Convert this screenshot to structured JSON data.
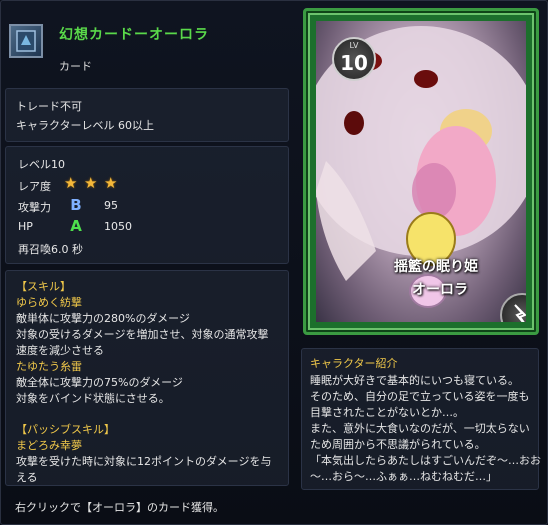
{
  "header": {
    "title": "幻想カードーオーロラ",
    "subtitle": "カード"
  },
  "trade": {
    "line1": "トレード不可",
    "line2": "キャラクターレベル 60以上"
  },
  "stats": {
    "level": "レベル10",
    "rarity_label": "レア度",
    "rarity_stars": 3,
    "attack_label": "攻撃力",
    "attack_grade": "B",
    "attack_value": "95",
    "hp_label": "HP",
    "hp_grade": "A",
    "hp_value": "1050",
    "resummon": "再召喚6.0 秒"
  },
  "skills": {
    "skill_header": "【スキル】",
    "skill1_name": "ゆらめく紡撃",
    "skill1_line1": "敵単体に攻撃力の280%のダメージ",
    "skill1_line2": "対象の受けるダメージを増加させ、対象の通常攻撃",
    "skill1_line3": "速度を減少させる",
    "skill2_name": "たゆたう糸雷",
    "skill2_line1": "敵全体に攻撃力の75%のダメージ",
    "skill2_line2": "対象をバインド状態にさせる。",
    "passive_header": "【パッシブスキル】",
    "passive_name": "まどろみ幸夢",
    "passive_line1": "攻撃を受けた時に対象に12ポイントのダメージを与",
    "passive_line2": "える"
  },
  "footer": {
    "text": "右クリックで【オーロラ】のカード獲得。"
  },
  "card": {
    "lv_label": "LV",
    "lv_value": "10",
    "caption1": "揺籃の眠り姫",
    "caption2": "オーロラ"
  },
  "intro": {
    "title": "キャラクター紹介",
    "line1": "睡眠が大好きで基本的にいつも寝ている。",
    "line2": "そのため、自分の足で立っている姿を一度も",
    "line3": "目撃されたことがないとか…。",
    "line4": "また、意外に大食いなのだが、一切太らない",
    "line5": "ため周囲から不思議がられている。",
    "line6": "「本気出したらあたしはすごいんだぞ〜…おお",
    "line7": "〜…おら〜…ふぁぁ…ねむねむだ…」"
  },
  "colors": {
    "title_green": "#5ad94a",
    "accent_yellow": "#f0c84a",
    "card_frame_green": "#3b9b42",
    "star_gold": "#f4b83a",
    "grade_b_blue": "#7fb0ff",
    "grade_a_green": "#4de04d"
  }
}
